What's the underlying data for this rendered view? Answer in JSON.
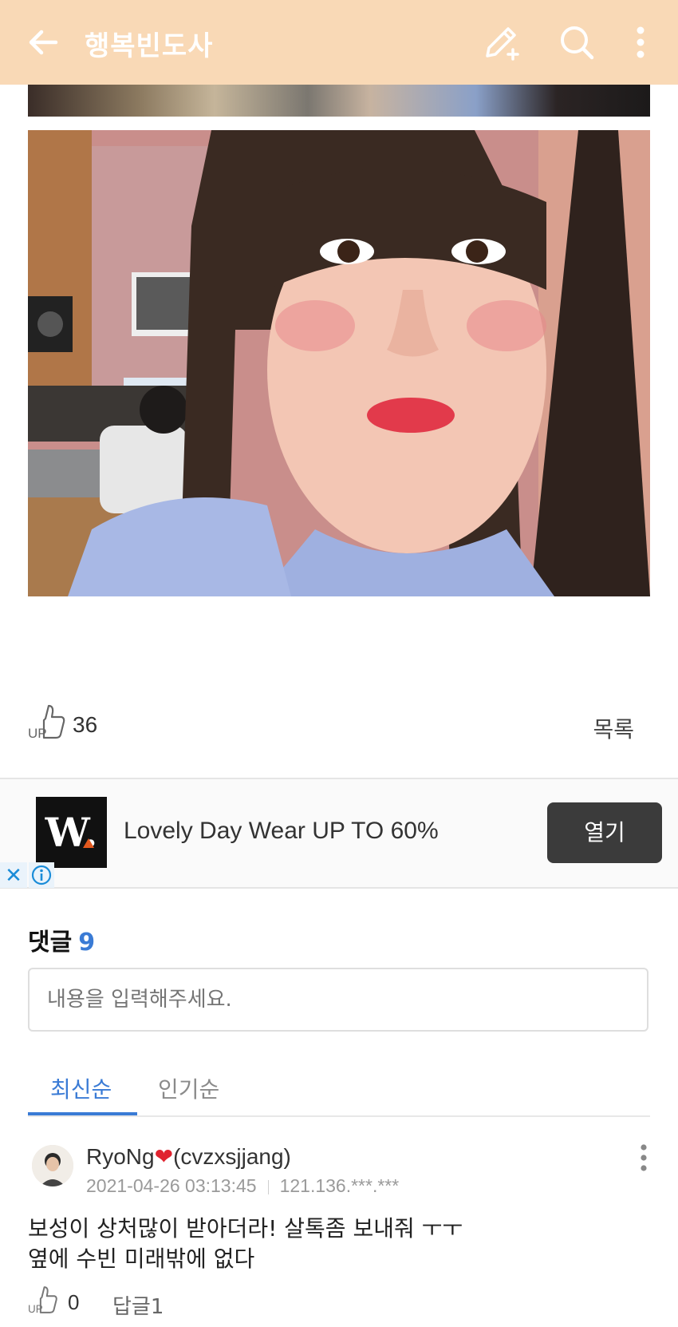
{
  "header": {
    "title": "행복빈도사"
  },
  "post": {
    "up_count": "36",
    "list_label": "목록"
  },
  "ad": {
    "logo_text": "W.",
    "text": "Lovely Day Wear UP TO 60%",
    "open_label": "열기",
    "close_glyph": "✕"
  },
  "comments": {
    "heading": "댓글",
    "count": "9",
    "input_placeholder": "내용을 입력해주세요.",
    "tabs": [
      {
        "label": "최신순"
      },
      {
        "label": "인기순"
      }
    ],
    "items": [
      {
        "user_name": "RyoNg",
        "heart": "❤",
        "user_id": "(cvzxsjjang)",
        "date": "2021-04-26 03:13:45",
        "ip": "121.136.***.***",
        "body_line1": "보성이 상처많이 받아더라! 살톡좀 보내줘 ㅜㅜ",
        "body_line2": "옆에 수빈 미래밖에 없다",
        "up_count": "0",
        "reply_label": "답글1"
      }
    ]
  },
  "colors": {
    "header_bg": "#f9d9b6",
    "accent": "#3a7bd5",
    "ad_button": "#3b3b3b"
  },
  "icons": {
    "back": "arrow-left-icon",
    "write": "pencil-plus-icon",
    "search": "search-icon",
    "more": "more-vertical-icon",
    "up": "thumbs-up-icon"
  }
}
